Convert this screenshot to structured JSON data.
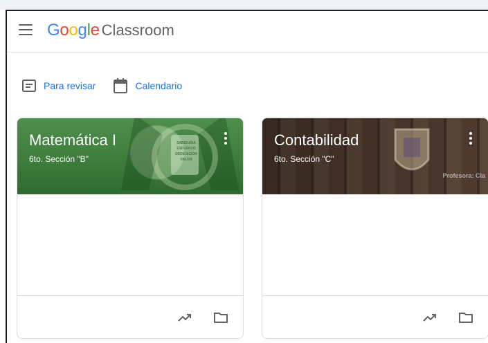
{
  "app": {
    "brand_google": "Google",
    "brand_classroom": "Classroom",
    "brand_colors": [
      "#4285f4",
      "#ea4335",
      "#fbbc05",
      "#4285f4",
      "#34a853",
      "#ea4335"
    ]
  },
  "quicklinks": [
    {
      "label": "Para revisar",
      "icon": "to-review-icon"
    },
    {
      "label": "Calendario",
      "icon": "calendar-icon"
    }
  ],
  "cards": [
    {
      "title": "Matemática I",
      "section": "6to. Sección \"B\"",
      "header_color": "#3e7d3c",
      "banner_words": [
        "SABIDURIA",
        "ESFUERZO",
        "DEDICACIÓN",
        "VALOR"
      ],
      "actions": [
        "trending-icon",
        "folder-icon"
      ]
    },
    {
      "title": "Contabilidad",
      "section": "6to. Sección \"C\"",
      "header_color": "#6b4f40",
      "watermark": "Profesora: Cla",
      "actions": [
        "trending-icon",
        "folder-icon"
      ]
    }
  ],
  "colors": {
    "link": "#1a73e8",
    "icon_gray": "#5f6368",
    "border": "#dadce0"
  }
}
